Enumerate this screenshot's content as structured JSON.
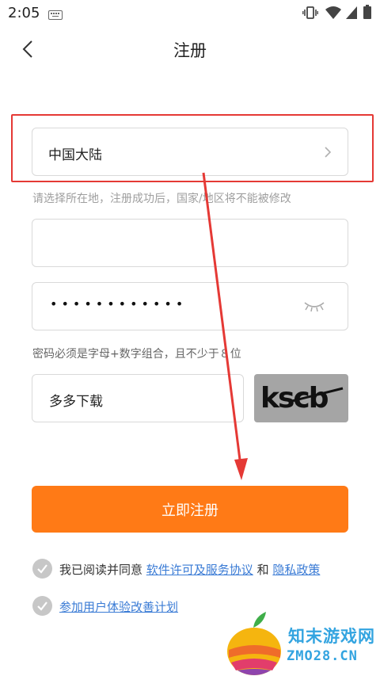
{
  "status_bar": {
    "time": "2:05"
  },
  "header": {
    "title": "注册"
  },
  "region": {
    "value": "中国大陆",
    "hint": "请选择所在地，注册成功后，国家/地区将不能被修改"
  },
  "phone": {
    "value": ""
  },
  "password": {
    "masked_value": "••••••••••••",
    "hint": "密码必须是字母+数字组合，且不少于８位"
  },
  "captcha": {
    "value": "多多下载",
    "image_text": "kscb"
  },
  "register_button": {
    "label": "立即注册"
  },
  "agreement": {
    "prefix": "我已阅读并同意 ",
    "license_link": "软件许可及服务协议",
    "conjunction": " 和 ",
    "privacy_link": "隐私政策"
  },
  "experience_plan": {
    "label": "参加用户体验改善计划"
  },
  "watermark": {
    "name": "知末游戏网",
    "domain": "ZMO28.CN"
  },
  "colors": {
    "accent": "#ff7a16",
    "link": "#3a7bd5",
    "annotation": "#e53935"
  }
}
